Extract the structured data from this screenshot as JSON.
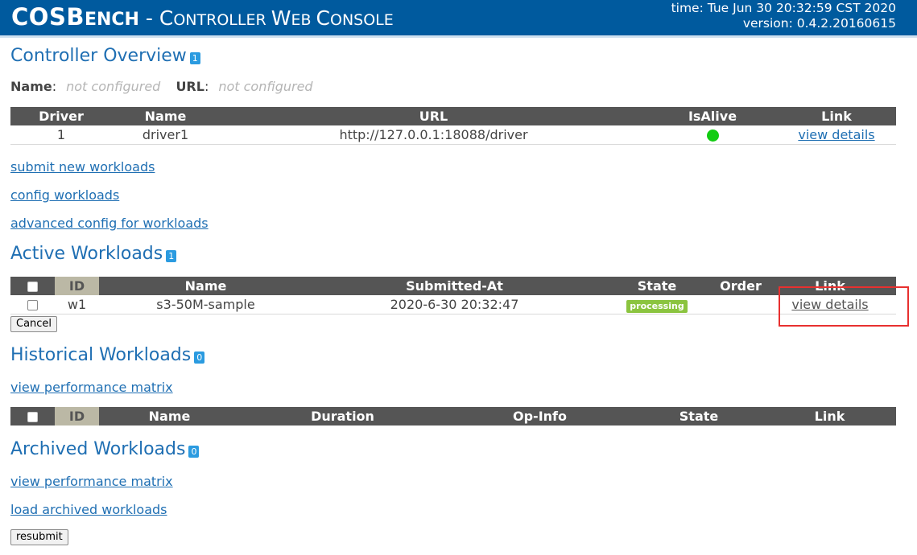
{
  "header": {
    "logo_c": "C",
    "logo_os": "OS",
    "logo_b": "B",
    "logo_ench": "ENCH",
    "logo_sep": " - ",
    "logo_c2": "C",
    "logo_ontroller": "ONTROLLER ",
    "logo_w": "W",
    "logo_eb": "EB ",
    "logo_c3": "C",
    "logo_onsole": "ONSOLE",
    "time": "time: Tue Jun 30 20:32:59 CST 2020",
    "version": "version: 0.4.2.20160615",
    "bg_color": "#005a9e"
  },
  "overview": {
    "title": "Controller Overview",
    "badge": "1",
    "name_label": "Name",
    "name_value": "not configured",
    "url_label": "URL",
    "url_value": "not configured",
    "columns": [
      "Driver",
      "Name",
      "URL",
      "IsAlive",
      "Link"
    ],
    "rows": [
      {
        "driver": "1",
        "name": "driver1",
        "url": "http://127.0.0.1:18088/driver",
        "alive_color": "#12cc12",
        "link": "view details"
      }
    ]
  },
  "links": {
    "submit": "submit new workloads",
    "config": "config workloads",
    "advanced": "advanced config for workloads"
  },
  "active": {
    "title": "Active Workloads",
    "badge": "1",
    "columns": [
      "ID",
      "Name",
      "Submitted-At",
      "State",
      "Order",
      "Link"
    ],
    "rows": [
      {
        "id": "w1",
        "name": "s3-50M-sample",
        "submitted": "2020-6-30 20:32:47",
        "state": "processing",
        "order": "",
        "link": "view details"
      }
    ],
    "cancel_label": "Cancel"
  },
  "historical": {
    "title": "Historical Workloads",
    "badge": "0",
    "matrix_link": "view performance matrix",
    "columns": [
      "ID",
      "Name",
      "Duration",
      "Op-Info",
      "State",
      "Link"
    ]
  },
  "archived": {
    "title": "Archived Workloads",
    "badge": "0",
    "matrix_link": "view performance matrix",
    "load_link": "load archived workloads",
    "resubmit_label": "resubmit"
  }
}
